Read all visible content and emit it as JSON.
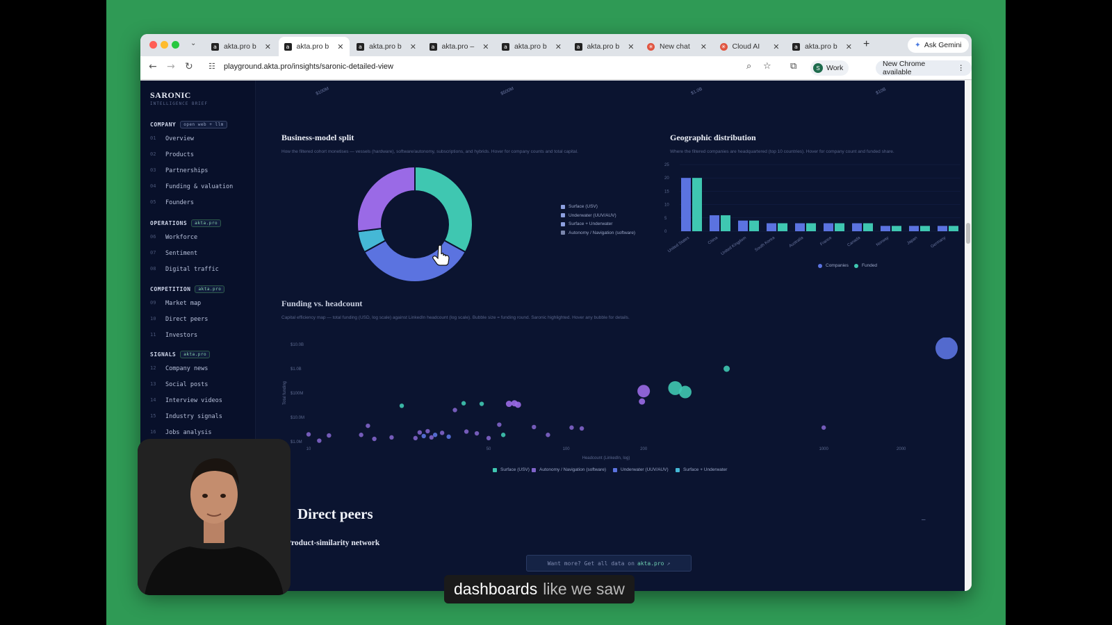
{
  "browser": {
    "tabs": [
      {
        "label": "akta.pro b",
        "active": false,
        "icon": "akta-icon"
      },
      {
        "label": "akta.pro b",
        "active": true,
        "icon": "akta-icon"
      },
      {
        "label": "akta.pro b",
        "active": false,
        "icon": "akta-icon"
      },
      {
        "label": "akta.pro –",
        "active": false,
        "icon": "amazon-icon"
      },
      {
        "label": "akta.pro b",
        "active": false,
        "icon": "akta-icon"
      },
      {
        "label": "akta.pro b",
        "active": false,
        "icon": "akta-icon"
      },
      {
        "label": "New chat",
        "active": false,
        "icon": "claude-icon"
      },
      {
        "label": "Cloud AI",
        "active": false,
        "icon": "claude-icon"
      },
      {
        "label": "akta.pro b",
        "active": false,
        "icon": "akta-icon"
      }
    ],
    "ask_gemini": "Ask Gemini",
    "url": "playground.akta.pro/insights/saronic-detailed-view",
    "profile_label": "Work",
    "profile_initial": "S",
    "update_label": "New Chrome available"
  },
  "sidebar": {
    "brand": "SARONIC",
    "brand_sub": "INTELLIGENCE BRIEF",
    "sections": [
      {
        "title": "COMPANY",
        "badge": "open web + llm",
        "items": [
          {
            "num": "01",
            "label": "Overview"
          },
          {
            "num": "02",
            "label": "Products"
          },
          {
            "num": "03",
            "label": "Partnerships"
          },
          {
            "num": "04",
            "label": "Funding & valuation"
          },
          {
            "num": "05",
            "label": "Founders"
          }
        ]
      },
      {
        "title": "OPERATIONS",
        "badge": "akta.pro",
        "items": [
          {
            "num": "06",
            "label": "Workforce"
          },
          {
            "num": "07",
            "label": "Sentiment"
          },
          {
            "num": "08",
            "label": "Digital traffic"
          }
        ]
      },
      {
        "title": "COMPETITION",
        "badge": "akta.pro",
        "items": [
          {
            "num": "09",
            "label": "Market map"
          },
          {
            "num": "10",
            "label": "Direct peers"
          },
          {
            "num": "11",
            "label": "Investors"
          }
        ]
      },
      {
        "title": "SIGNALS",
        "badge": "akta.pro",
        "items": [
          {
            "num": "12",
            "label": "Company news"
          },
          {
            "num": "13",
            "label": "Social posts"
          },
          {
            "num": "14",
            "label": "Interview videos"
          },
          {
            "num": "15",
            "label": "Industry signals"
          },
          {
            "num": "16",
            "label": "Jobs analysis"
          }
        ]
      }
    ]
  },
  "main": {
    "top_axis_ticks": [
      "$100M",
      "$500M",
      "$1.0B",
      "$10B"
    ],
    "business_model": {
      "title": "Business-model split",
      "subtitle": "How the filtered cohort monetises — vessels (hardware), software/autonomy, subscriptions, and hybrids. Hover for company counts and total capital.",
      "legend": [
        "Surface (USV)",
        "Underwater (UUV/AUV)",
        "Surface + Underwater",
        "Autonomy / Navigation (software)"
      ]
    },
    "geo": {
      "title": "Geographic distribution",
      "subtitle": "Where the filtered companies are headquartered (top 10 countries). Hover for company count and funded share.",
      "legend": [
        "Companies",
        "Funded"
      ]
    },
    "funding": {
      "title": "Funding vs. headcount",
      "subtitle": "Capital efficiency map — total funding (USD, log scale) against LinkedIn headcount (log scale). Bubble size = funding round. Saronic highlighted. Hover any bubble for details.",
      "x_label": "Headcount (LinkedIn, log)",
      "y_label": "Total funding",
      "legend": [
        "Surface (USV)",
        "Autonomy / Navigation (software)",
        "Underwater (UUV/AUV)",
        "Surface + Underwater"
      ]
    },
    "peers_title": "Direct peers",
    "peers_sub": "Product-similarity network",
    "cta": {
      "text": "Want more? Get all data on",
      "brand": "akta.pro",
      "arrow": "↗"
    }
  },
  "caption": {
    "bold": "dashboards",
    "rest": "like we saw"
  },
  "colors": {
    "teal": "#3fc7b1",
    "blue": "#5b73e0",
    "purple": "#9a6ae6",
    "cyan": "#45b8d6",
    "page_bg": "#0b1430",
    "sidebar_bg": "#08102a",
    "frame_green": "#2f9a55"
  },
  "chart_data": [
    {
      "type": "pie",
      "title": "Business-model split",
      "categories": [
        "Surface (USV)",
        "Underwater (UUV/AUV)",
        "Surface + Underwater",
        "Autonomy / Navigation (software)"
      ],
      "values": [
        33,
        34,
        6,
        27
      ],
      "donut": true
    },
    {
      "type": "bar",
      "title": "Geographic distribution",
      "categories": [
        "United States",
        "China",
        "United Kingdom",
        "South Korea",
        "Australia",
        "France",
        "Canada",
        "Norway",
        "Japan",
        "Germany"
      ],
      "series": [
        {
          "name": "Companies",
          "values": [
            20,
            6,
            4,
            3,
            3,
            3,
            3,
            2,
            2,
            2
          ]
        },
        {
          "name": "Funded",
          "values": [
            20,
            6,
            4,
            3,
            3,
            3,
            3,
            2,
            2,
            2
          ]
        }
      ],
      "ylim": [
        0,
        25
      ],
      "yticks": [
        0,
        5,
        10,
        15,
        20,
        25
      ]
    },
    {
      "type": "scatter",
      "title": "Funding vs. headcount",
      "x_scale": "log",
      "y_scale": "log",
      "xticks": [
        10,
        50,
        100,
        200,
        1000,
        2000
      ],
      "yticks_labels": [
        "$1.0M",
        "$10.0M",
        "$100M",
        "$1.0B",
        "$10.0B"
      ],
      "yticks_values": [
        1000000.0,
        10000000.0,
        100000000.0,
        1000000000.0,
        10000000000.0
      ],
      "points": [
        {
          "x": 10,
          "y": 2000000.0,
          "s": 1,
          "c": "purple"
        },
        {
          "x": 12,
          "y": 1800000.0,
          "s": 1,
          "c": "purple"
        },
        {
          "x": 11,
          "y": 1100000.0,
          "s": 1,
          "c": "purple"
        },
        {
          "x": 16,
          "y": 1900000.0,
          "s": 1,
          "c": "purple"
        },
        {
          "x": 17,
          "y": 4500000.0,
          "s": 1,
          "c": "purple"
        },
        {
          "x": 18,
          "y": 1300000.0,
          "s": 1,
          "c": "purple"
        },
        {
          "x": 21,
          "y": 1500000.0,
          "s": 1,
          "c": "purple"
        },
        {
          "x": 23,
          "y": 30000000.0,
          "s": 1,
          "c": "teal"
        },
        {
          "x": 26,
          "y": 1400000.0,
          "s": 1,
          "c": "purple"
        },
        {
          "x": 27,
          "y": 2400000.0,
          "s": 1,
          "c": "purple"
        },
        {
          "x": 28,
          "y": 1700000.0,
          "s": 1,
          "c": "blue"
        },
        {
          "x": 29,
          "y": 2700000.0,
          "s": 1,
          "c": "purple"
        },
        {
          "x": 30,
          "y": 1500000.0,
          "s": 1,
          "c": "purple"
        },
        {
          "x": 31,
          "y": 1900000.0,
          "s": 1,
          "c": "blue"
        },
        {
          "x": 33,
          "y": 2300000.0,
          "s": 1,
          "c": "purple"
        },
        {
          "x": 35,
          "y": 1600000.0,
          "s": 1,
          "c": "blue"
        },
        {
          "x": 37,
          "y": 20000000.0,
          "s": 1,
          "c": "purple"
        },
        {
          "x": 40,
          "y": 38000000.0,
          "s": 1,
          "c": "teal"
        },
        {
          "x": 41,
          "y": 2600000.0,
          "s": 1,
          "c": "purple"
        },
        {
          "x": 45,
          "y": 2200000.0,
          "s": 1,
          "c": "purple"
        },
        {
          "x": 47,
          "y": 36000000.0,
          "s": 1,
          "c": "teal"
        },
        {
          "x": 50,
          "y": 1400000.0,
          "s": 1,
          "c": "purple"
        },
        {
          "x": 55,
          "y": 5000000.0,
          "s": 1,
          "c": "purple"
        },
        {
          "x": 57,
          "y": 1900000.0,
          "s": 1,
          "c": "teal"
        },
        {
          "x": 60,
          "y": 36000000.0,
          "s": 2,
          "c": "purple"
        },
        {
          "x": 63,
          "y": 38000000.0,
          "s": 2,
          "c": "purple"
        },
        {
          "x": 65,
          "y": 33000000.0,
          "s": 2,
          "c": "purple"
        },
        {
          "x": 75,
          "y": 4000000.0,
          "s": 1,
          "c": "purple"
        },
        {
          "x": 85,
          "y": 1900000.0,
          "s": 1,
          "c": "purple"
        },
        {
          "x": 105,
          "y": 3800000.0,
          "s": 1,
          "c": "purple"
        },
        {
          "x": 115,
          "y": 3500000.0,
          "s": 1,
          "c": "purple"
        },
        {
          "x": 200,
          "y": 120000000.0,
          "s": 3,
          "c": "purple"
        },
        {
          "x": 197,
          "y": 45000000.0,
          "s": 2,
          "c": "purple"
        },
        {
          "x": 265,
          "y": 160000000.0,
          "s": 4,
          "c": "teal"
        },
        {
          "x": 290,
          "y": 110000000.0,
          "s": 3,
          "c": "teal"
        },
        {
          "x": 420,
          "y": 1000000000.0,
          "s": 2,
          "c": "teal"
        },
        {
          "x": 1000,
          "y": 3800000.0,
          "s": 1,
          "c": "purple"
        },
        {
          "x": 3000,
          "y": 7000000000.0,
          "s": 5,
          "c": "blue"
        }
      ]
    }
  ]
}
